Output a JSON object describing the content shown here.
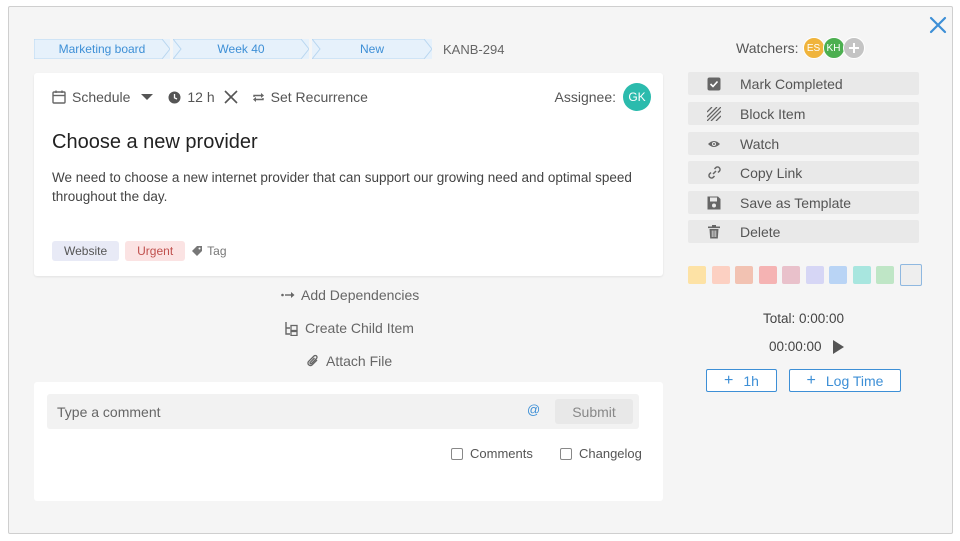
{
  "breadcrumb": {
    "items": [
      "Marketing board",
      "Week 40",
      "New"
    ],
    "id": "KANB-294"
  },
  "card": {
    "schedule_label": "Schedule",
    "hours_label": "12 h",
    "recurrence_label": "Set Recurrence",
    "assignee_label": "Assignee:",
    "assignee_initials": "GK",
    "title": "Choose a new provider",
    "description": "We need to choose a new internet provider that can support our growing need and optimal speed throughout the day.",
    "tags": [
      {
        "label": "Website",
        "bg": "#e8eaf6",
        "color": "#555"
      },
      {
        "label": "Urgent",
        "bg": "#fbe3e3",
        "color": "#c0504d"
      }
    ],
    "tag_add_label": "Tag"
  },
  "actions": {
    "add_dependencies": "Add Dependencies",
    "create_child": "Create Child Item",
    "attach_file": "Attach File"
  },
  "comment": {
    "placeholder": "Type a comment",
    "mention_symbol": "@",
    "submit_label": "Submit",
    "filter_comments": "Comments",
    "filter_changelog": "Changelog"
  },
  "watchers": {
    "label": "Watchers:",
    "avatars": [
      {
        "initials": "ES",
        "color": "#f0b43c"
      },
      {
        "initials": "KH",
        "color": "#4caf50"
      }
    ]
  },
  "side_actions": {
    "mark_completed": "Mark Completed",
    "block_item": "Block Item",
    "watch": "Watch",
    "copy_link": "Copy Link",
    "save_template": "Save as Template",
    "delete": "Delete"
  },
  "colors": {
    "accent": "#3d8fd6",
    "swatches": [
      "#fde2a5",
      "#fcd0c2",
      "#f2c2b2",
      "#f5b3b3",
      "#e9c1cb",
      "#d6d6f5",
      "#b9d4f5",
      "#a8e6df",
      "#bfe6c6",
      "#eeeeee"
    ]
  },
  "time": {
    "total_label": "Total: 0:00:00",
    "timer_value": "00:00:00",
    "add_hour_label": "1h",
    "log_time_label": "Log Time"
  }
}
